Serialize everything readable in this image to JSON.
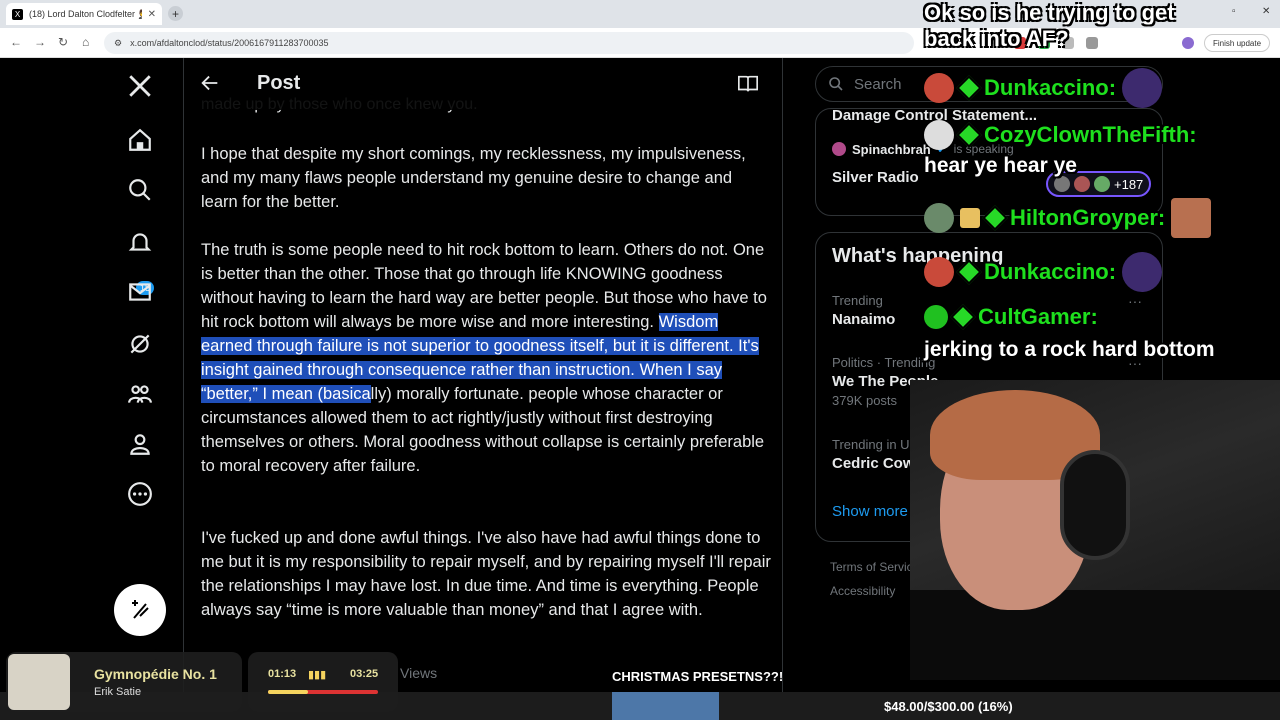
{
  "browser": {
    "tab_title": "(18) Lord Dalton Clodfelter 🤵 o",
    "url": "x.com/afdaltonclod/status/2006167911283700035",
    "finish_update": "Finish update"
  },
  "nav": {
    "notif_count": "18"
  },
  "post": {
    "header_title": "Post",
    "cut_line": "made up by those who once knew you.",
    "p1": "I hope that despite my short comings, my recklessness, my impulsiveness, and my many flaws people understand my genuine desire to change and learn for the better.",
    "p2_a": "The truth is some people need to hit rock bottom to learn. Others do not. One is better than the other. Those that go through life KNOWING goodness without having to learn the hard way are better people. But those who have to hit rock bottom will always be more wise and more interesting. ",
    "p2_hl": "Wisdom earned through failure is not superior to goodness itself, but it is different. It's insight gained through consequence rather than instruction. When I say “better,” I mean (basica",
    "p2_b": "lly) morally fortunate. people whose character or circumstances allowed them to act rightly/justly without first destroying themselves or others. Moral goodness without collapse is certainly preferable to moral recovery after failure.",
    "p3": "I've fucked up and done awful things. I've also have had awful things done to me but it is my responsibility to repair myself, and by repairing myself I'll repair the relationships I may have lost. In due time. And time is everything. People always say “time is more valuable than money” and that I agree with.",
    "views": "Views"
  },
  "sidebar": {
    "search_placeholder": "Search",
    "space_cut": "Damage Control Statement...",
    "space_host": "Spinachbrah",
    "space_status": "is speaking",
    "space_title": "Silver Radio",
    "listeners": "+187",
    "happening_title": "What's happening",
    "trends": [
      {
        "meta": "Trending",
        "name": "Nanaimo",
        "count": ""
      },
      {
        "meta": "Politics · Trending",
        "name": "We The People",
        "count": "379K posts"
      },
      {
        "meta": "Trending in United",
        "name": "Cedric Cowar",
        "count": ""
      }
    ],
    "show_more": "Show more",
    "legal_1": "Terms of Service",
    "legal_2": "Accessibility"
  },
  "overlay": {
    "top_message": "Ok so is he trying to get back into AF?",
    "chat": [
      {
        "user": "Dunkaccino:",
        "msg": ""
      },
      {
        "user": "CozyClownTheFifth:",
        "msg": "hear ye hear ye"
      },
      {
        "user": "HiltonGroyper:",
        "msg": ""
      },
      {
        "user": "Dunkaccino:",
        "msg": ""
      },
      {
        "user": "CultGamer:",
        "msg": "jerking to a rock hard bottom"
      }
    ],
    "ticker": "CHRISTMAS PRESETNS??!",
    "goal": "$48.00/$300.00 (16%)",
    "goal_fraction": 0.16,
    "song": "Gymnopédie No. 1",
    "artist": "Erik Satie",
    "time_elapsed": "01:13",
    "time_total": "03:25"
  }
}
